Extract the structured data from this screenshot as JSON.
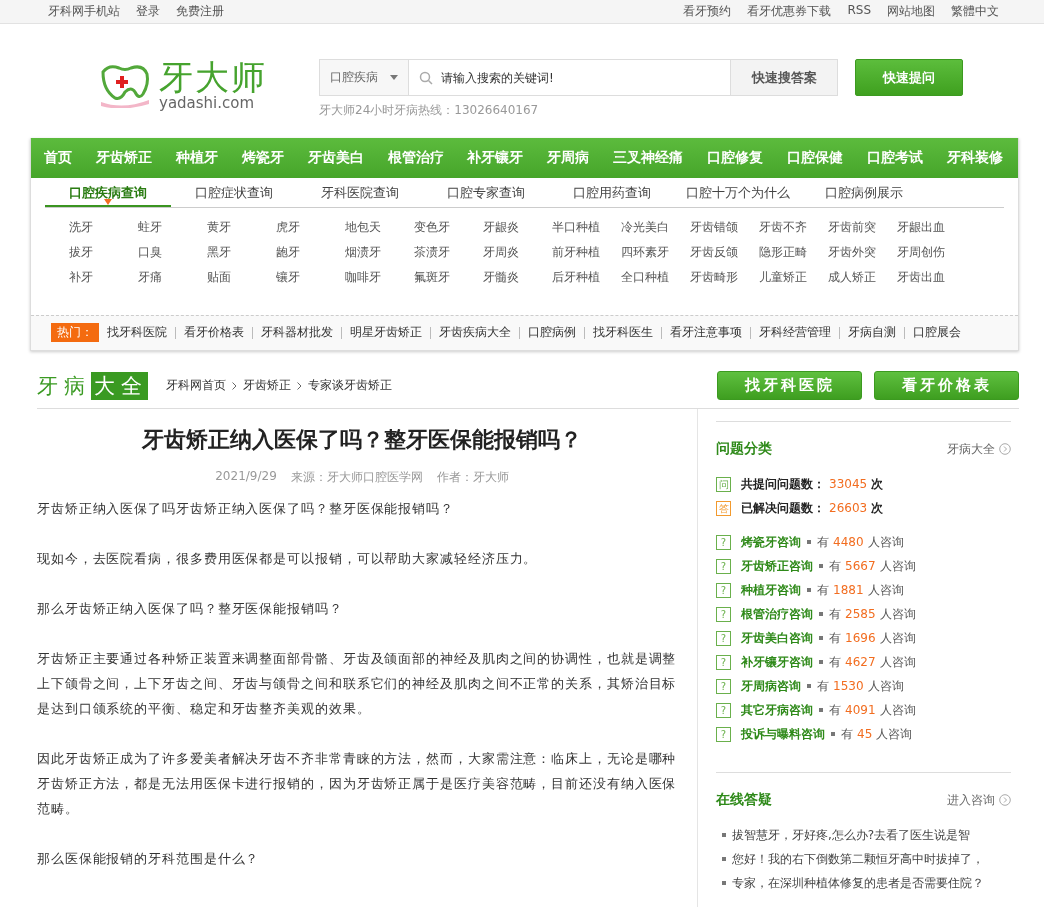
{
  "top_bar": {
    "left_links": [
      "牙科网手机站",
      "登录",
      "免费注册"
    ],
    "right_links": [
      "看牙预约",
      "看牙优惠券下载",
      "RSS",
      "网站地图",
      "繁體中文"
    ]
  },
  "logo": {
    "name": "牙大师",
    "domain": "yadashi.com"
  },
  "search": {
    "category": "口腔疾病",
    "placeholder": "请输入搜索的关键词!",
    "search_button": "快速搜答案",
    "ask_button": "快速提问",
    "hotline": "牙大师24小时牙病热线：13026640167"
  },
  "main_nav": [
    "首页",
    "牙齿矫正",
    "种植牙",
    "烤瓷牙",
    "牙齿美白",
    "根管治疗",
    "补牙镶牙",
    "牙周病",
    "三叉神经痛",
    "口腔修复",
    "口腔保健",
    "口腔考试",
    "牙科装修"
  ],
  "sub_tabs": [
    {
      "label": "口腔疾病查询",
      "selected": true
    },
    {
      "label": "口腔症状查询",
      "selected": false
    },
    {
      "label": "牙科医院查询",
      "selected": false
    },
    {
      "label": "口腔专家查询",
      "selected": false
    },
    {
      "label": "口腔用药查询",
      "selected": false
    },
    {
      "label": "口腔十万个为什么",
      "selected": false
    },
    {
      "label": "口腔病例展示",
      "selected": false
    }
  ],
  "keywords": [
    "洗牙",
    "蛀牙",
    "黄牙",
    "虎牙",
    "地包天",
    "变色牙",
    "牙龈炎",
    "半口种植",
    "冷光美白",
    "牙齿错颌",
    "牙齿不齐",
    "牙齿前突",
    "牙龈出血",
    "拔牙",
    "口臭",
    "黑牙",
    "龅牙",
    "烟渍牙",
    "茶渍牙",
    "牙周炎",
    "前牙种植",
    "四环素牙",
    "牙齿反颌",
    "隐形正畸",
    "牙齿外突",
    "牙周创伤",
    "补牙",
    "牙痛",
    "贴面",
    "镶牙",
    "咖啡牙",
    "氟斑牙",
    "牙髓炎",
    "后牙种植",
    "全口种植",
    "牙齿畸形",
    "儿童矫正",
    "成人矫正",
    "牙齿出血"
  ],
  "hot": {
    "label": "热门：",
    "links": [
      "找牙科医院",
      "看牙价格表",
      "牙科器材批发",
      "明星牙齿矫正",
      "牙齿疾病大全",
      "口腔病例",
      "找牙科医生",
      "看牙注意事项",
      "牙科经营管理",
      "牙病自测",
      "口腔展会"
    ]
  },
  "section": {
    "title_a": "牙病",
    "title_b": "大全",
    "breadcrumb": [
      "牙科网首页",
      "牙齿矫正",
      "专家谈牙齿矫正"
    ],
    "buttons": [
      "找牙科医院",
      "看牙价格表"
    ]
  },
  "article": {
    "title": "牙齿矫正纳入医保了吗？整牙医保能报销吗？",
    "date": "2021/9/29",
    "source": "来源：牙大师口腔医学网",
    "author": "作者：牙大师",
    "paragraphs": [
      "牙齿矫正纳入医保了吗牙齿矫正纳入医保了吗？整牙医保能报销吗？",
      "现如今，去医院看病，很多费用医保都是可以报销，可以帮助大家减轻经济压力。",
      "那么牙齿矫正纳入医保了吗？整牙医保能报销吗？",
      "牙齿矫正主要通过各种矫正装置来调整面部骨骼、牙齿及颌面部的神经及肌肉之间的协调性，也就是调整上下颌骨之间，上下牙齿之间、牙齿与颌骨之间和联系它们的神经及肌肉之间不正常的关系，其矫治目标是达到口颌系统的平衡、稳定和牙齿整齐美观的效果。",
      "因此牙齿矫正成为了许多爱美者解决牙齿不齐非常青睐的方法，然而，大家需注意：临床上，无论是哪种牙齿矫正方法，都是无法用医保卡进行报销的，因为牙齿矫正属于是医疗美容范畴，目前还没有纳入医保范畴。",
      "那么医保能报销的牙科范围是什么？"
    ]
  },
  "categories": {
    "title": "问题分类",
    "more": "牙病大全",
    "stats": [
      {
        "kind": "ask",
        "badge": "问",
        "label": "共提问问题数：",
        "count": "33045",
        "unit": "次"
      },
      {
        "kind": "answer",
        "badge": "答",
        "label": "已解决问题数：",
        "count": "26603",
        "unit": "次"
      }
    ],
    "items": [
      {
        "badge": "?",
        "name": "烤瓷牙咨询",
        "prefix": "有",
        "count": "4480",
        "suffix": "人咨询"
      },
      {
        "badge": "?",
        "name": "牙齿矫正咨询",
        "prefix": "有",
        "count": "5667",
        "suffix": "人咨询"
      },
      {
        "badge": "?",
        "name": "种植牙咨询",
        "prefix": "有",
        "count": "1881",
        "suffix": "人咨询"
      },
      {
        "badge": "?",
        "name": "根管治疗咨询",
        "prefix": "有",
        "count": "2585",
        "suffix": "人咨询"
      },
      {
        "badge": "?",
        "name": "牙齿美白咨询",
        "prefix": "有",
        "count": "1696",
        "suffix": "人咨询"
      },
      {
        "badge": "?",
        "name": "补牙镶牙咨询",
        "prefix": "有",
        "count": "4627",
        "suffix": "人咨询"
      },
      {
        "badge": "?",
        "name": "牙周病咨询",
        "prefix": "有",
        "count": "1530",
        "suffix": "人咨询"
      },
      {
        "badge": "?",
        "name": "其它牙病咨询",
        "prefix": "有",
        "count": "4091",
        "suffix": "人咨询"
      },
      {
        "badge": "?",
        "name": "投诉与曝料咨询",
        "prefix": "有",
        "count": "45",
        "suffix": "人咨询"
      }
    ]
  },
  "online": {
    "title": "在线答疑",
    "more": "进入咨询",
    "questions": [
      "拔智慧牙，牙好疼,怎么办?去看了医生说是智",
      "您好！我的右下倒数第二颗恒牙高中时拔掉了，",
      "专家，在深圳种植体修复的患者是否需要住院？"
    ]
  }
}
